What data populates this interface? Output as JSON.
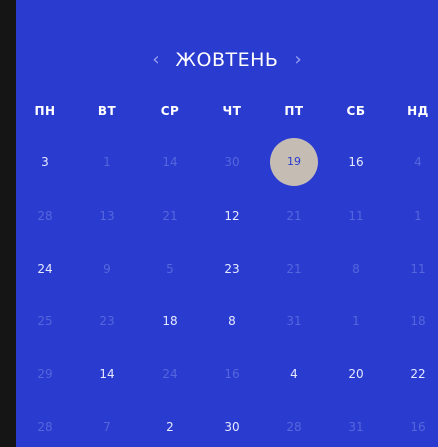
{
  "calendar": {
    "month_title": "жовтень",
    "prev_arrow": "‹",
    "next_arrow": "›",
    "weekdays": [
      "ПН",
      "ВТ",
      "СР",
      "ЧТ",
      "ПТ",
      "СБ",
      "НД"
    ],
    "selected_day": "19",
    "rows": [
      [
        {
          "t": "3",
          "on": true
        },
        {
          "t": "1",
          "on": false
        },
        {
          "t": "14",
          "on": false
        },
        {
          "t": "30",
          "on": false
        },
        {
          "t": "19",
          "on": true,
          "sel": true
        },
        {
          "t": "16",
          "on": true
        },
        {
          "t": "4",
          "on": false
        }
      ],
      [
        {
          "t": "28",
          "on": false
        },
        {
          "t": "13",
          "on": false
        },
        {
          "t": "21",
          "on": false
        },
        {
          "t": "12",
          "on": true
        },
        {
          "t": "21",
          "on": false
        },
        {
          "t": "11",
          "on": false
        },
        {
          "t": "1",
          "on": false
        }
      ],
      [
        {
          "t": "24",
          "on": true
        },
        {
          "t": "9",
          "on": false
        },
        {
          "t": "5",
          "on": false
        },
        {
          "t": "23",
          "on": true
        },
        {
          "t": "21",
          "on": false
        },
        {
          "t": "8",
          "on": false
        },
        {
          "t": "11",
          "on": false
        }
      ],
      [
        {
          "t": "25",
          "on": false
        },
        {
          "t": "23",
          "on": false
        },
        {
          "t": "18",
          "on": true
        },
        {
          "t": "8",
          "on": true
        },
        {
          "t": "31",
          "on": false
        },
        {
          "t": "1",
          "on": false
        },
        {
          "t": "18",
          "on": false
        }
      ],
      [
        {
          "t": "29",
          "on": false
        },
        {
          "t": "14",
          "on": true
        },
        {
          "t": "24",
          "on": false
        },
        {
          "t": "16",
          "on": false
        },
        {
          "t": "4",
          "on": true
        },
        {
          "t": "20",
          "on": true
        },
        {
          "t": "22",
          "on": true
        }
      ],
      [
        {
          "t": "28",
          "on": false
        },
        {
          "t": "7",
          "on": false
        },
        {
          "t": "2",
          "on": true
        },
        {
          "t": "30",
          "on": true
        },
        {
          "t": "28",
          "on": false
        },
        {
          "t": "31",
          "on": false
        },
        {
          "t": "16",
          "on": false
        }
      ]
    ]
  }
}
